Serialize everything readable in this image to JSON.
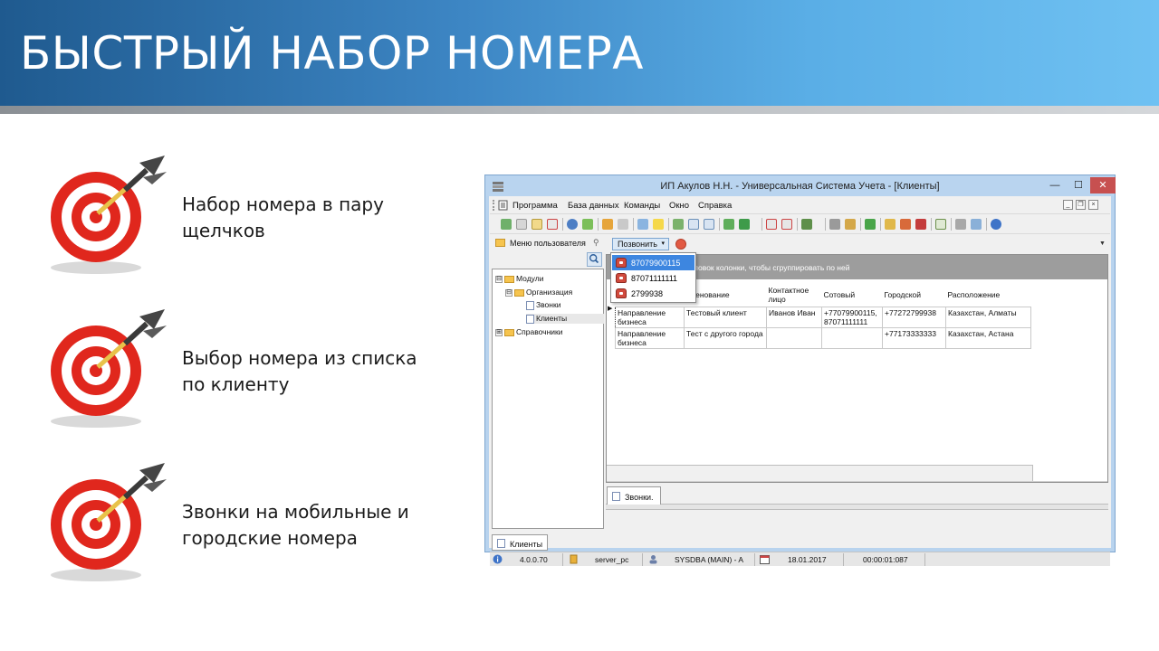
{
  "slide": {
    "title": "БЫСТРЫЙ НАБОР НОМЕРА",
    "bullets": [
      {
        "icon": "target-icon",
        "line1": "Набор номера в пару",
        "line2": "щелчков"
      },
      {
        "icon": "target-icon",
        "line1": "Выбор номера из списка",
        "line2": "по клиенту"
      },
      {
        "icon": "target-icon",
        "line1": "Звонки на мобильные и",
        "line2": "городские номера"
      }
    ]
  },
  "window": {
    "title": "ИП Акулов Н.Н. - Универсальная Система Учета - [Клиенты]",
    "controls": {
      "minimize": "—",
      "maximize": "☐",
      "close": "✕"
    },
    "menu": [
      "Программа",
      "База данных",
      "Команды",
      "Окно",
      "Справка"
    ],
    "left_panel": {
      "tab_label": "Меню пользователя",
      "tree": [
        {
          "label": "Модули",
          "expander": "⊟"
        },
        {
          "label": "Организация",
          "expander": "⊟"
        },
        {
          "label": "Звонки"
        },
        {
          "label": "Клиенты"
        },
        {
          "label": "Справочники",
          "expander": "⊞"
        }
      ]
    },
    "call_button": {
      "label": "Позвонить",
      "caret": "▾"
    },
    "dropdown": {
      "phones": [
        "87079900115",
        "87071111111",
        "2799938"
      ]
    },
    "grid": {
      "group_hint": "ловок колонки, чтобы сгруппировать по ней",
      "columns": [
        "",
        "именование",
        "Контактное лицо",
        "Сотовый",
        "Городской",
        "Расположение"
      ],
      "rows": [
        [
          "Направление бизнеса",
          "Тестовый клиент",
          "Иванов Иван",
          "+77079900115, 87071111111",
          "+77272799938",
          "Казахстан, Алматы"
        ],
        [
          "Направление бизнеса",
          "Тест с другого города",
          "",
          "",
          "+77173333333",
          "Казахстан, Астана"
        ]
      ]
    },
    "sub_tab": "Звонки.",
    "doc_tab": "Клиенты",
    "status": {
      "version": "4.0.0.70",
      "server": "server_pc",
      "user": "SYSDBA (MAIN) - A",
      "date": "18.01.2017",
      "timer": "00:00:01:087"
    }
  },
  "colors": {
    "header_dark": "#1f5a8f",
    "header_light": "#6fc1f2",
    "target_red": "#e0271d",
    "selection_blue": "#3d86e0",
    "group_panel_gray": "#9d9d9d"
  }
}
